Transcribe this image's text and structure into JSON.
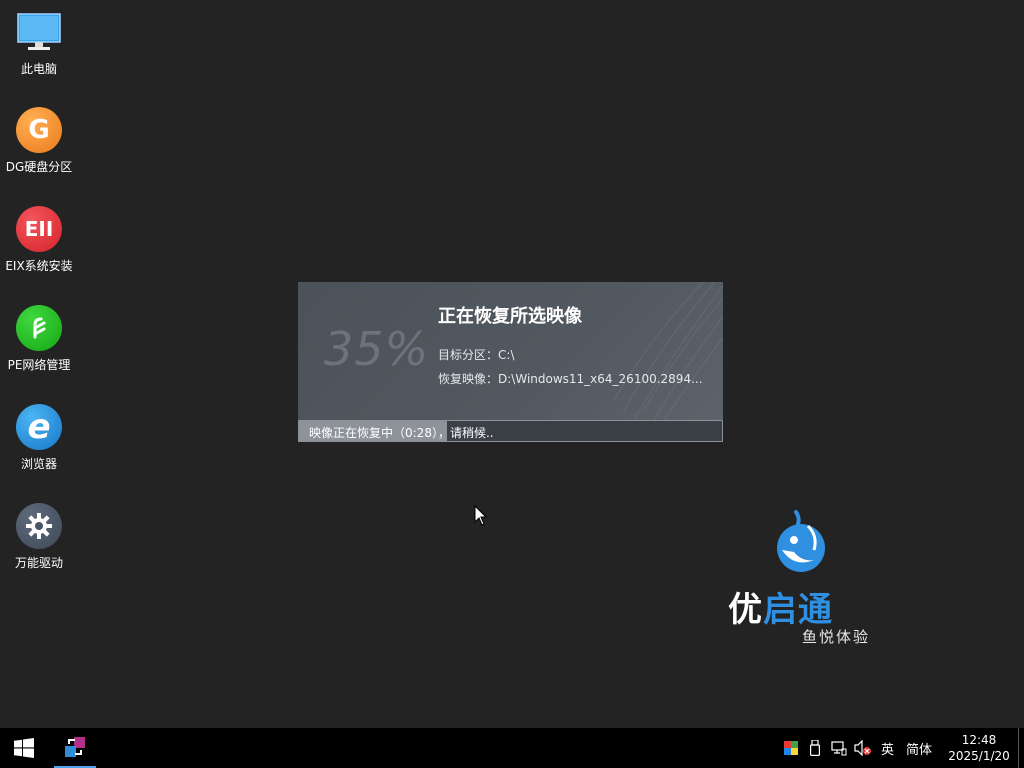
{
  "desktop": {
    "icons": [
      {
        "label": "此电脑",
        "icon": "computer-icon"
      },
      {
        "label": "DG硬盘分区",
        "icon": "diskgenius-icon",
        "glyph": "G"
      },
      {
        "label": "EIX系统安装",
        "icon": "eix-installer-icon",
        "glyph": "EII"
      },
      {
        "label": "PE网络管理",
        "icon": "network-manager-icon"
      },
      {
        "label": "浏览器",
        "icon": "browser-icon",
        "glyph": "e"
      },
      {
        "label": "万能驱动",
        "icon": "driver-gear-icon"
      }
    ]
  },
  "dialog": {
    "percent": "35%",
    "progress_fraction": 0.35,
    "title": "正在恢复所选映像",
    "target_label": "目标分区：",
    "target_value": "C:\\",
    "image_label": "恢复映像：",
    "image_value": "D:\\Windows11_x64_26100.2894...",
    "status_text": "映像正在恢复中（0:28），请稍候.."
  },
  "brand": {
    "name_white": "优",
    "name_blue": "启通",
    "slogan": "鱼悦体验"
  },
  "taskbar": {
    "start_icon": "windows-start-icon",
    "app_icon": "restore-app-icon",
    "tray": {
      "ime_lang": "英",
      "ime_mode": "简体",
      "time": "12:48",
      "date": "2025/1/20"
    }
  },
  "colors": {
    "desktop_bg": "#232323",
    "dialog_bg": "#52585f",
    "brand_blue": "#2f8fe0",
    "dg_orange": "#f0892a",
    "eix_red": "#e0333a",
    "pe_green": "#1fba1f",
    "browser_blue": "#1e8fd6",
    "driver_gray": "#4a5566"
  }
}
